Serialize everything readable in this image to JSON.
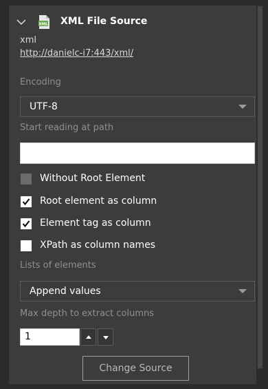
{
  "source": {
    "title": "XML File Source",
    "type": "xml",
    "url": "http://danielc-i7:443/xml/",
    "icon": "xml-file-icon"
  },
  "encoding": {
    "label": "Encoding",
    "selected": "UTF-8"
  },
  "path": {
    "label": "Start reading at path",
    "value": ""
  },
  "options": [
    {
      "label": "Without Root Element",
      "checked": false,
      "disabled": true
    },
    {
      "label": "Root element as column",
      "checked": true,
      "disabled": false
    },
    {
      "label": "Element tag as column",
      "checked": true,
      "disabled": false
    },
    {
      "label": "XPath as column names",
      "checked": false,
      "disabled": false
    }
  ],
  "lists": {
    "label": "Lists of elements",
    "selected": "Append values"
  },
  "depth": {
    "label": "Max depth to extract columns",
    "value": "1"
  },
  "actions": {
    "change_source": "Change Source"
  },
  "colors": {
    "panel": "#3c3c3c",
    "icon_green": "#6aa84f",
    "muted_text": "#8f8f8f"
  }
}
